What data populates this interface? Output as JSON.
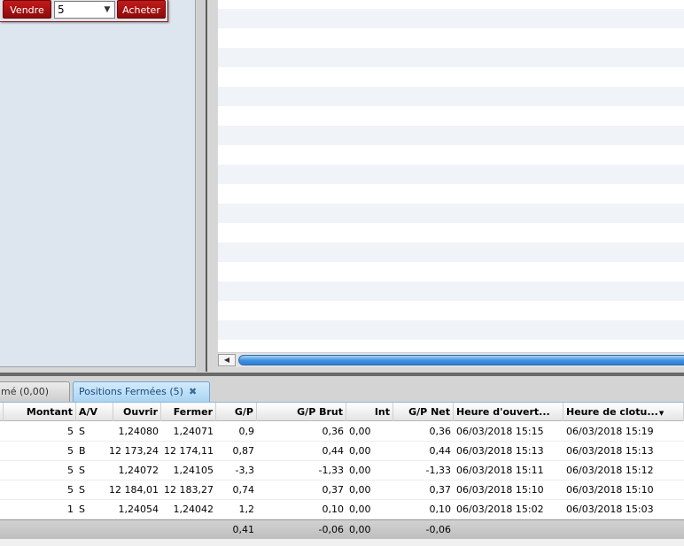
{
  "order": {
    "sell_label": "Vendre",
    "quantity": "5",
    "buy_label": "Acheter"
  },
  "tabs": [
    {
      "label": "mé (0,00)"
    },
    {
      "label": "Positions Fermées (5)"
    }
  ],
  "grid": {
    "columns": {
      "amount": "Montant",
      "side": "A/V",
      "open": "Ouvrir",
      "close": "Fermer",
      "pl": "G/P",
      "pl_gross": "G/P Brut",
      "interest": "Int",
      "pl_net": "G/P Net",
      "open_time": "Heure d'ouvert...",
      "close_time": "Heure de clotu..."
    },
    "rows": [
      {
        "amount": "5",
        "side": "S",
        "open": "1,24080",
        "close": "1,24071",
        "pl": "0,9",
        "pl_gross": "0,36",
        "interest": "0,00",
        "pl_net": "0,36",
        "open_time": "06/03/2018 15:15",
        "close_time": "06/03/2018 15:19"
      },
      {
        "amount": "5",
        "side": "B",
        "open": "12 173,24",
        "close": "12 174,11",
        "pl": "0,87",
        "pl_gross": "0,44",
        "interest": "0,00",
        "pl_net": "0,44",
        "open_time": "06/03/2018 15:13",
        "close_time": "06/03/2018 15:13"
      },
      {
        "amount": "5",
        "side": "S",
        "open": "1,24072",
        "close": "1,24105",
        "pl": "-3,3",
        "pl_gross": "-1,33",
        "interest": "0,00",
        "pl_net": "-1,33",
        "open_time": "06/03/2018 15:11",
        "close_time": "06/03/2018 15:12"
      },
      {
        "amount": "5",
        "side": "S",
        "open": "12 184,01",
        "close": "12 183,27",
        "pl": "0,74",
        "pl_gross": "0,37",
        "interest": "0,00",
        "pl_net": "0,37",
        "open_time": "06/03/2018 15:10",
        "close_time": "06/03/2018 15:10"
      },
      {
        "amount": "1",
        "side": "S",
        "open": "1,24054",
        "close": "1,24042",
        "pl": "1,2",
        "pl_gross": "0,10",
        "interest": "0,00",
        "pl_net": "0,10",
        "open_time": "06/03/2018 15:02",
        "close_time": "06/03/2018 15:03"
      }
    ],
    "totals": {
      "pl": "0,41",
      "pl_gross": "-0,06",
      "interest": "0,00",
      "pl_net": "-0,06"
    }
  }
}
